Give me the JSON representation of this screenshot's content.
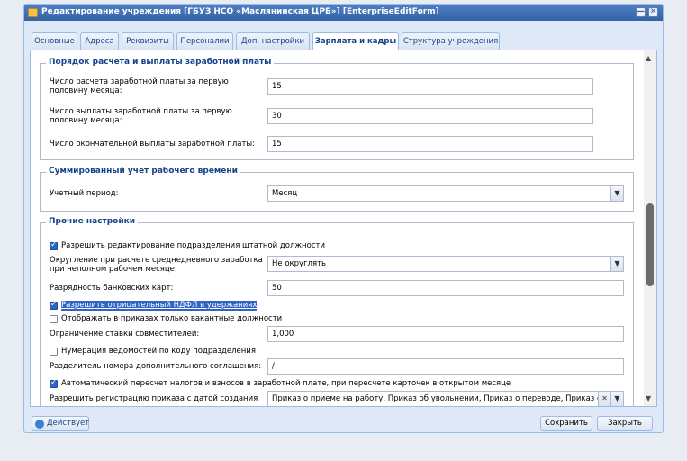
{
  "window": {
    "title": "Редактирование учреждения [ГБУЗ НСО «Маслянинская ЦРБ»] [EnterpriseEditForm]",
    "tool_minimize": "—",
    "tool_close": "✕"
  },
  "tabs": [
    {
      "label": "Основные"
    },
    {
      "label": "Адреса"
    },
    {
      "label": "Реквизиты"
    },
    {
      "label": "Персоналии"
    },
    {
      "label": "Доп. настройки"
    },
    {
      "label": "Зарплата и кадры",
      "active": true
    },
    {
      "label": "Структура учреждения"
    }
  ],
  "salary": {
    "legend": "Порядок расчета и выплаты заработной платы",
    "fields": [
      {
        "label_l1": "Число расчета заработной платы за первую",
        "label_l2": "половину месяца:",
        "value": "15"
      },
      {
        "label_l1": "Число выплаты заработной платы за первую",
        "label_l2": "половину месяца:",
        "value": "30"
      },
      {
        "label_l1": "Число окончательной выплаты заработной платы:",
        "label_l2": "",
        "value": "15"
      }
    ]
  },
  "worktime": {
    "legend": "Суммированный учет рабочего времени",
    "period_label": "Учетный период:",
    "period_value": "Месяц"
  },
  "other": {
    "legend": "Прочие настройки",
    "allow_edit_label": "Разрешить редактирование подразделения штатной должности",
    "allow_edit_checked": true,
    "rounding_label_l1": "Округление при расчете среднедневного заработка",
    "rounding_label_l2": "при неполном рабочем месяце:",
    "rounding_value": "Не округлять",
    "card_digits_label": "Разрядность банковских карт:",
    "card_digits_value": "50",
    "negative_ndfl_label": "Разрешить отрицательный НДФЛ в удержаниях",
    "negative_ndfl_checked": true,
    "vacant_only_label": "Отображать в приказах только вакантные должности",
    "vacant_only_checked": false,
    "rate_limit_label": "Ограничение ставки совместителей:",
    "rate_limit_value": "1,000",
    "numbering_label": "Нумерация ведомостей по коду подразделения",
    "numbering_checked": false,
    "separator_label": "Разделитель номера дополнительного соглашения:",
    "separator_value": "/",
    "auto_recalc_label": "Автоматический пересчет налогов и взносов в заработной плате, при пересчете карточек в открытом месяце",
    "auto_recalc_checked": true,
    "order_date_label": "Разрешить регистрацию приказа с датой создания",
    "order_date_value": "Приказ о приеме на работу, Приказ об увольнении, Приказ о переводе, Приказ об"
  },
  "footer": {
    "status_label": "Действует",
    "save_label": "Сохранить",
    "close_label": "Закрыть"
  },
  "colors": {
    "titlebar": "#3363a6",
    "legend_text": "#15428b",
    "checkbox_on": "#2f63c4"
  }
}
